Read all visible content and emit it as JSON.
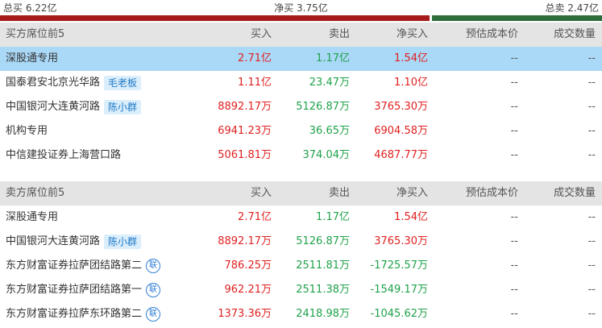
{
  "summary": {
    "total_buy_label": "总买 6.22亿",
    "net_buy_label": "净买 3.75亿",
    "total_sell_label": "总卖 2.47亿",
    "total_buy": 6.22,
    "total_sell": 2.47,
    "buy_color": "#a61b1b",
    "sell_color": "#2e6e3b"
  },
  "headers": {
    "buy_section_title": "买方席位前5",
    "sell_section_title": "卖方席位前5",
    "buy": "买入",
    "sell": "卖出",
    "net": "净买入",
    "cost": "预估成本价",
    "volume": "成交数量"
  },
  "buy_rows": [
    {
      "name": "深股通专用",
      "tag": "",
      "icon": "",
      "buy": "2.71亿",
      "sell": "1.17亿",
      "net": "1.54亿",
      "cost": "--",
      "volume": "--"
    },
    {
      "name": "国泰君安北京光华路",
      "tag": "毛老板",
      "icon": "",
      "buy": "1.11亿",
      "sell": "23.47万",
      "net": "1.10亿",
      "cost": "--",
      "volume": "--"
    },
    {
      "name": "中国银河大连黄河路",
      "tag": "陈小群",
      "icon": "",
      "buy": "8892.17万",
      "sell": "5126.87万",
      "net": "3765.30万",
      "cost": "--",
      "volume": "--"
    },
    {
      "name": "机构专用",
      "tag": "",
      "icon": "",
      "buy": "6941.23万",
      "sell": "36.65万",
      "net": "6904.58万",
      "cost": "--",
      "volume": "--"
    },
    {
      "name": "中信建投证券上海营口路",
      "tag": "",
      "icon": "",
      "buy": "5061.81万",
      "sell": "374.04万",
      "net": "4687.77万",
      "cost": "--",
      "volume": "--"
    }
  ],
  "sell_rows": [
    {
      "name": "深股通专用",
      "tag": "",
      "icon": "",
      "buy": "2.71亿",
      "sell": "1.17亿",
      "net": "1.54亿",
      "cost": "--",
      "volume": "--"
    },
    {
      "name": "中国银河大连黄河路",
      "tag": "陈小群",
      "icon": "",
      "buy": "8892.17万",
      "sell": "5126.87万",
      "net": "3765.30万",
      "cost": "--",
      "volume": "--"
    },
    {
      "name": "东方财富证券拉萨团结路第二",
      "tag": "",
      "icon": "联",
      "buy": "786.25万",
      "sell": "2511.81万",
      "net": "-1725.57万",
      "cost": "--",
      "volume": "--"
    },
    {
      "name": "东方财富证券拉萨团结路第一",
      "tag": "",
      "icon": "联",
      "buy": "962.21万",
      "sell": "2511.38万",
      "net": "-1549.17万",
      "cost": "--",
      "volume": "--"
    },
    {
      "name": "东方财富证券拉萨东环路第二",
      "tag": "",
      "icon": "联",
      "buy": "1373.36万",
      "sell": "2418.98万",
      "net": "-1045.62万",
      "cost": "--",
      "volume": "--"
    }
  ]
}
